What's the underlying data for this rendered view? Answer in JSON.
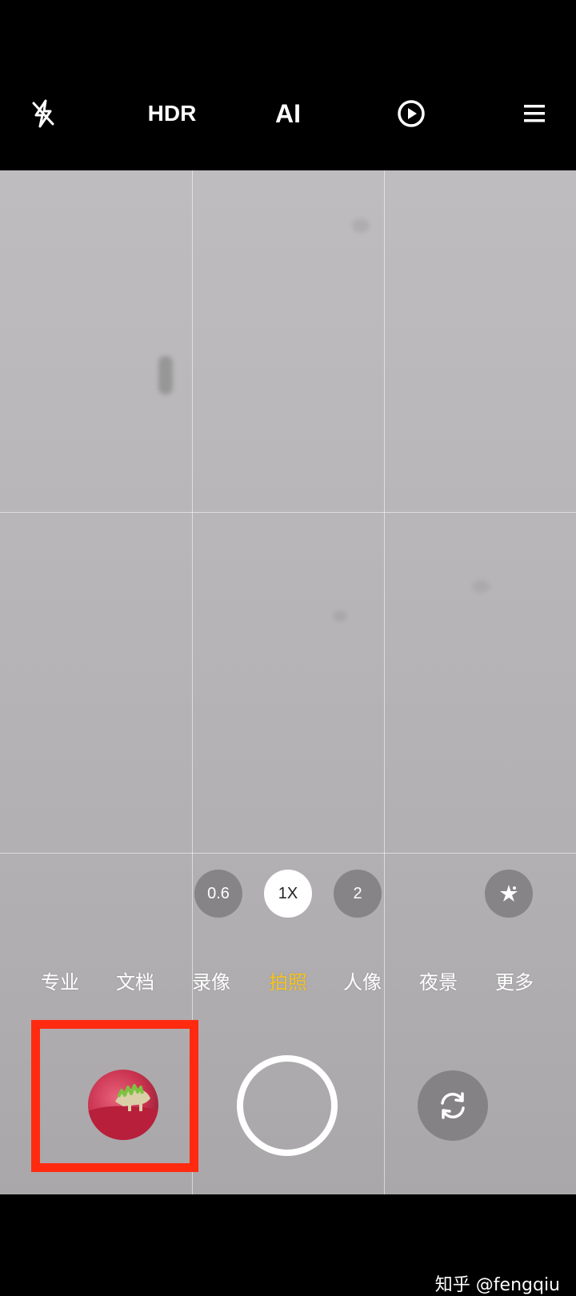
{
  "top_bar": {
    "flash_icon": "flash-off-icon",
    "hdr_label": "HDR",
    "ai_label": "AI",
    "live_icon": "live-photo-icon",
    "menu_icon": "menu-icon"
  },
  "zoom": {
    "options": [
      "0.6",
      "1X",
      "2"
    ],
    "selected": "1X"
  },
  "beauty_icon": "sparkle-icon",
  "modes": [
    "专业",
    "文档",
    "录像",
    "拍照",
    "人像",
    "夜景",
    "更多"
  ],
  "active_mode": "拍照",
  "colors": {
    "active_mode": "#f3c224",
    "highlight": "#ff2a10"
  },
  "watermark": "知乎 @fengqiu"
}
